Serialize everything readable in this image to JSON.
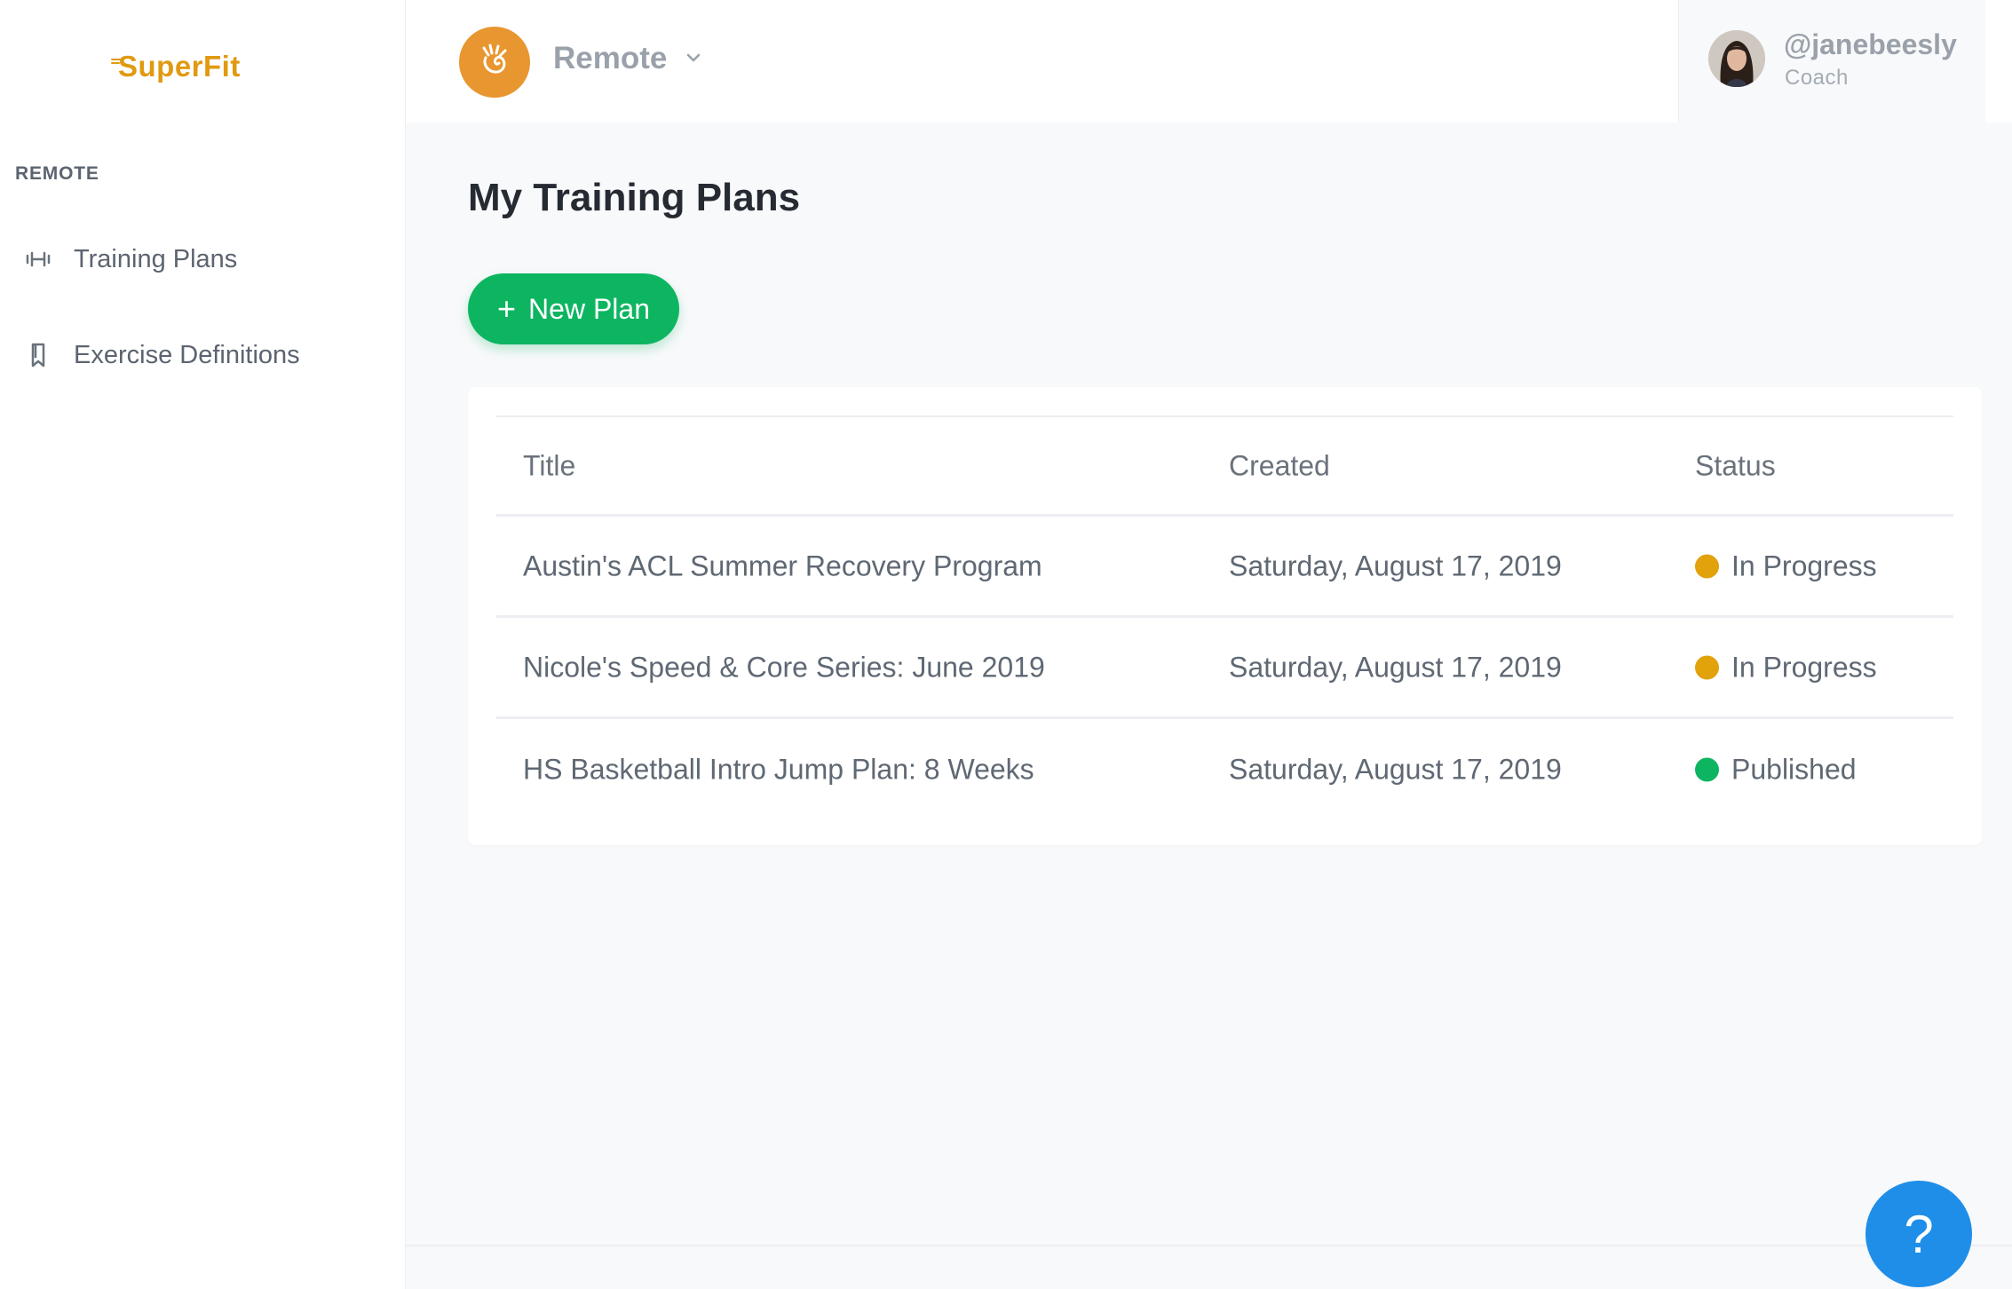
{
  "app": {
    "logo_text": "SuperFit"
  },
  "sidebar": {
    "section_label": "REMOTE",
    "items": [
      {
        "label": "Training Plans",
        "icon": "dumbbell-icon"
      },
      {
        "label": "Exercise Definitions",
        "icon": "bookmark-icon"
      }
    ]
  },
  "header": {
    "org_name": "Remote",
    "org_icon": "hand-icon",
    "user": {
      "username": "@janebeesly",
      "role": "Coach"
    }
  },
  "main": {
    "title": "My Training Plans",
    "new_plan_label": "New Plan",
    "table": {
      "columns": [
        "Title",
        "Created",
        "Status"
      ],
      "rows": [
        {
          "title": "Austin's ACL Summer Recovery Program",
          "created": "Saturday, August 17, 2019",
          "status": "In Progress",
          "status_color": "#e1a20c"
        },
        {
          "title": "Nicole's Speed & Core Series: June 2019",
          "created": "Saturday, August 17, 2019",
          "status": "In Progress",
          "status_color": "#e1a20c"
        },
        {
          "title": "HS Basketball Intro Jump Plan: 8 Weeks",
          "created": "Saturday, August 17, 2019",
          "status": "Published",
          "status_color": "#0db561"
        }
      ]
    }
  },
  "help": {
    "label": "?"
  },
  "colors": {
    "brand": "#e09a12",
    "primary_button": "#0db561",
    "help_button": "#1f8ee8",
    "org_logo_bg": "#e8962f"
  }
}
